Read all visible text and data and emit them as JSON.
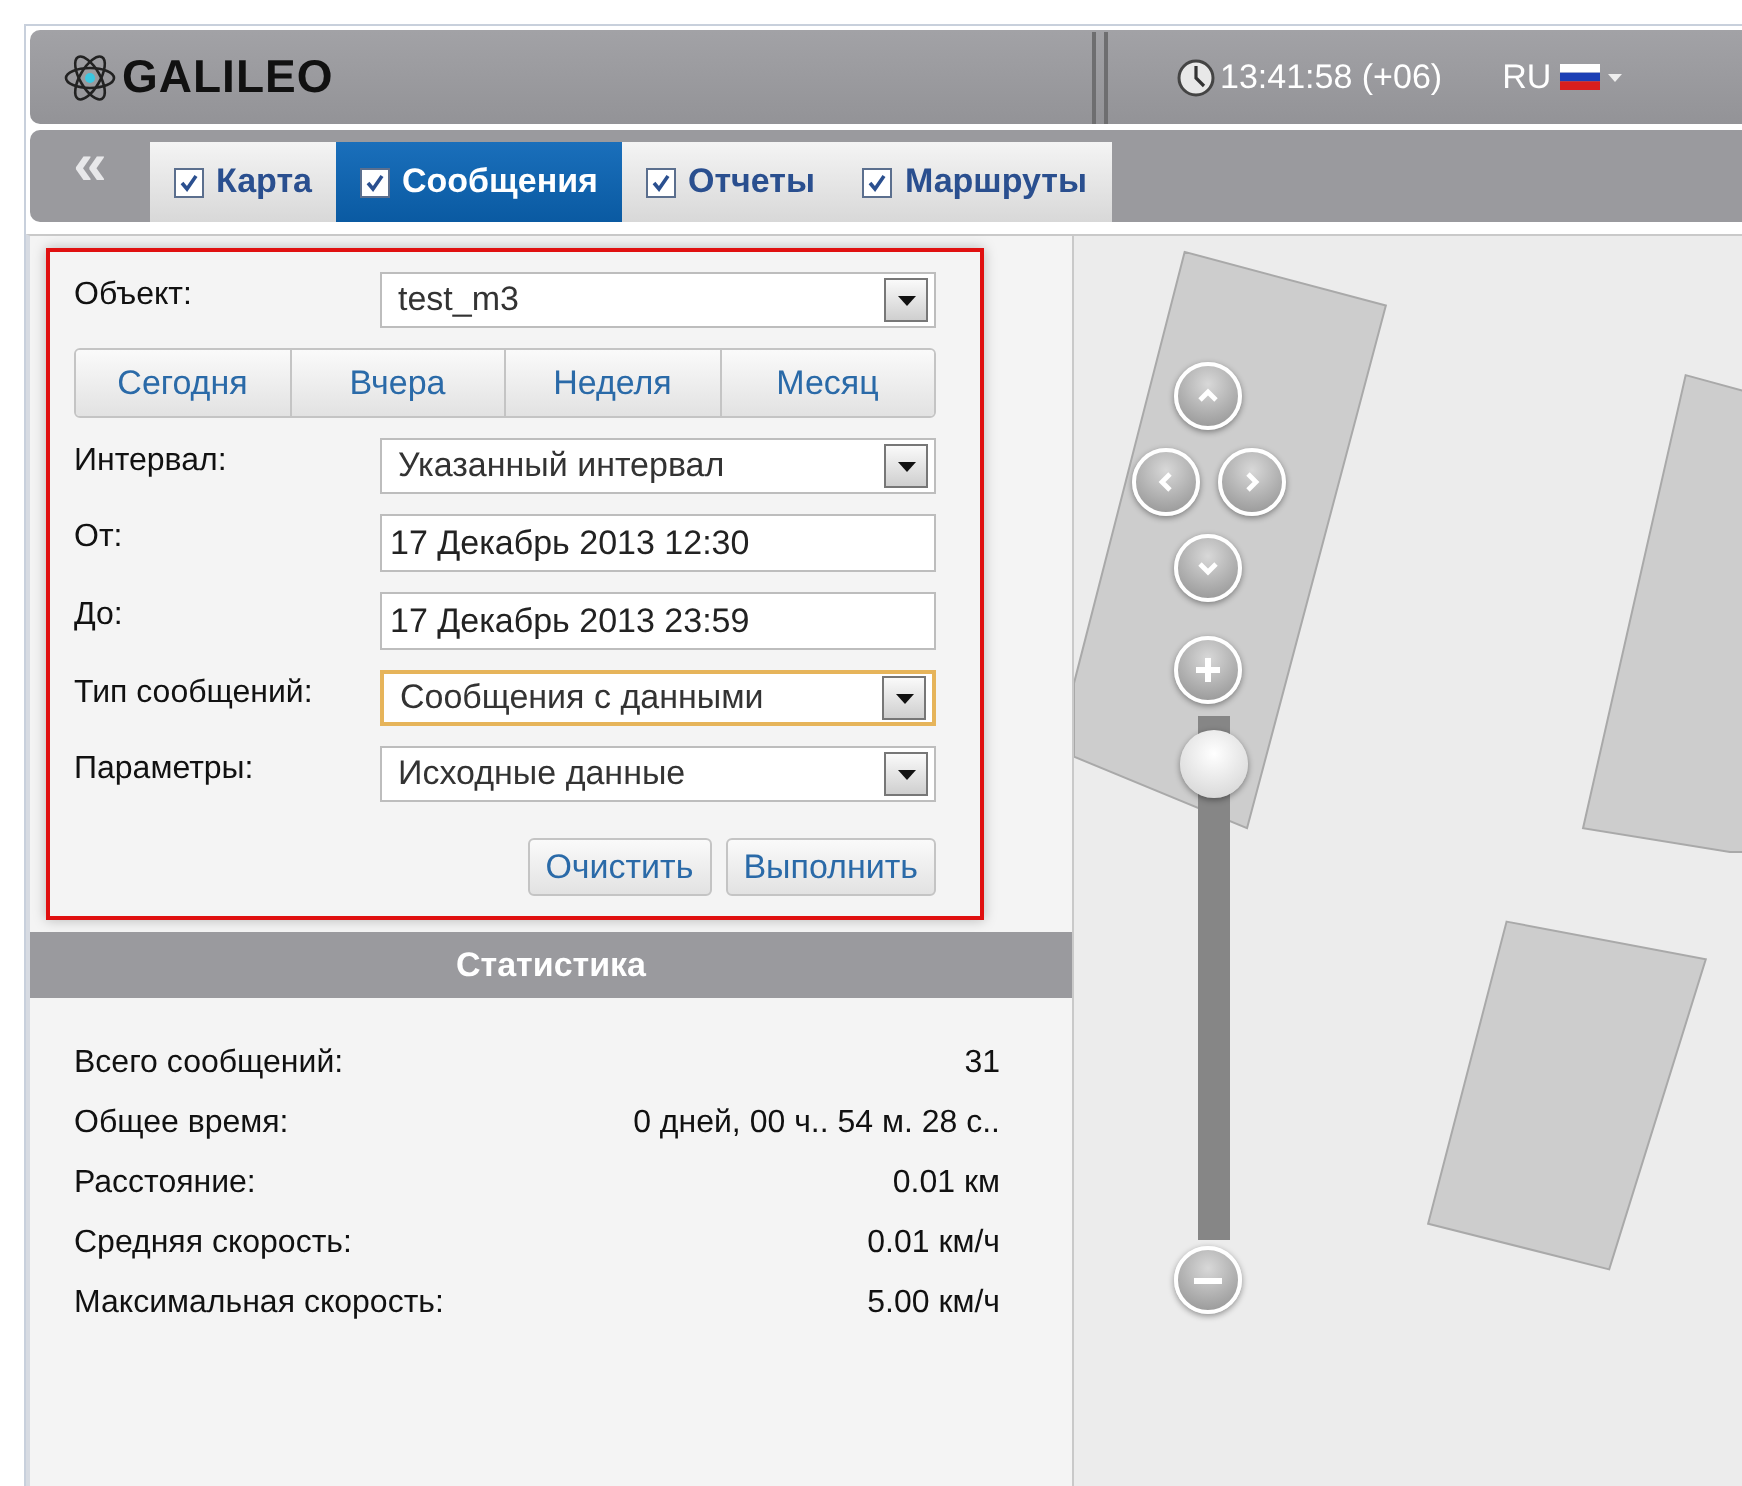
{
  "header": {
    "logo": "GALILEO",
    "time": "13:41:58 (+06)",
    "language": "RU"
  },
  "tabs": [
    {
      "label": "Карта",
      "checked": true,
      "selected": false
    },
    {
      "label": "Сообщения",
      "checked": true,
      "selected": true
    },
    {
      "label": "Отчеты",
      "checked": true,
      "selected": false
    },
    {
      "label": "Маршруты",
      "checked": true,
      "selected": false
    }
  ],
  "collapse_button": "«",
  "form": {
    "object": {
      "label": "Объект:",
      "value": "test_m3"
    },
    "periods": [
      "Сегодня",
      "Вчера",
      "Неделя",
      "Месяц"
    ],
    "fields": [
      {
        "kind": "select",
        "label": "Интервал:",
        "value": "Указанный интервал",
        "focused": false
      },
      {
        "kind": "input",
        "label": "От:",
        "value": "17 Декабрь 2013 12:30",
        "focused": false
      },
      {
        "kind": "input",
        "label": "До:",
        "value": "17 Декабрь 2013 23:59",
        "focused": false
      },
      {
        "kind": "select",
        "label": "Тип сообщений:",
        "value": "Сообщения с данными",
        "focused": true
      },
      {
        "kind": "select",
        "label": "Параметры:",
        "value": "Исходные данные",
        "focused": false
      }
    ],
    "buttons": [
      "Очистить",
      "Выполнить"
    ]
  },
  "statistics": {
    "title": "Статистика",
    "rows": [
      {
        "label": "Всего сообщений:",
        "value": "31"
      },
      {
        "label": "Общее время:",
        "value": "0 дней, 00 ч.. 54 м. 28 с.."
      },
      {
        "label": "Расстояние:",
        "value": "0.01 км"
      },
      {
        "label": "Средняя скорость:",
        "value": "0.01 км/ч"
      },
      {
        "label": "Максимальная скорость:",
        "value": "5.00 км/ч"
      }
    ]
  },
  "map": {
    "zoom": {
      "level": 0.97
    }
  }
}
